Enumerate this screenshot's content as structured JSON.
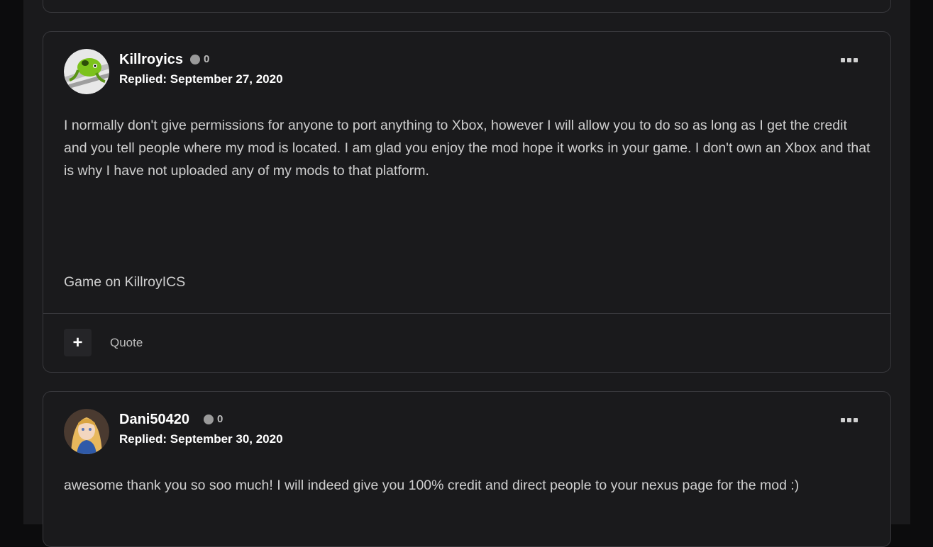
{
  "posts": [
    {
      "username": "Killroyics",
      "reputation": "0",
      "replied": "Replied: September 27, 2020",
      "paragraphs": [
        "I normally don't give permissions for anyone to port anything to Xbox, however I will allow you to do so as long as I get the credit and you tell people where my mod is located. I am glad you enjoy the mod hope it works in your game. I don't own an Xbox and that is why I have not uploaded any of my mods to that platform.",
        "Game on KillroyICS"
      ],
      "actions": {
        "add_label": "+",
        "quote_label": "Quote"
      }
    },
    {
      "username": "Dani50420",
      "reputation": "0",
      "replied": "Replied: September 30, 2020",
      "paragraphs": [
        "awesome thank you so soo much! I will indeed give you 100% credit and direct people to your nexus page for the mod :)"
      ]
    }
  ]
}
